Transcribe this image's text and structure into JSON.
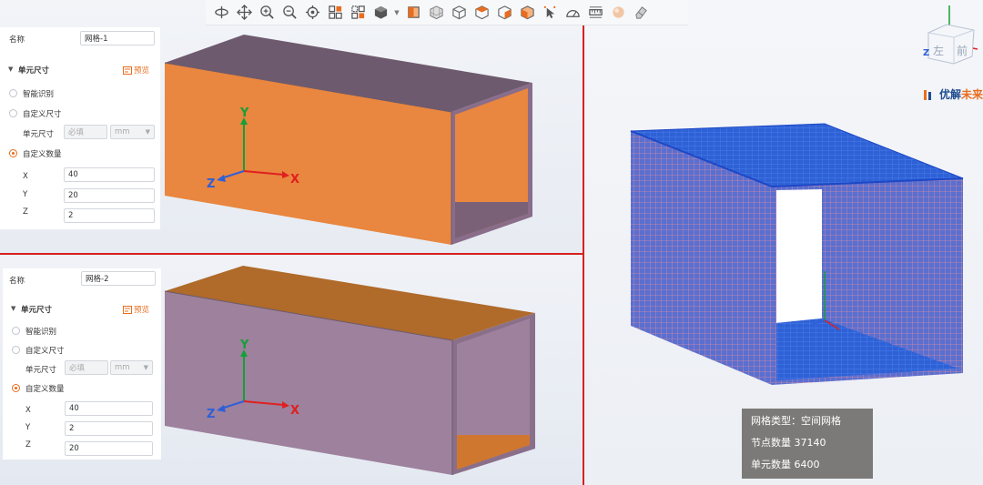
{
  "toolbar": {
    "icons": [
      "rotate-icon",
      "pan-icon",
      "zoom-in-icon",
      "zoom-out-icon",
      "target-icon",
      "fit-all-icon",
      "fit-selection-icon",
      "view-cube-icon",
      "front-view-icon",
      "grid-cube-icon",
      "iso-view-icon",
      "top-view-icon",
      "right-view-icon",
      "bottom-view-icon",
      "select-point-icon",
      "angle-measure-icon",
      "ruler-icon",
      "material-sphere-icon",
      "eraser-icon"
    ]
  },
  "panel1": {
    "name_label": "名称",
    "name_value": "网格-1",
    "section_title": "单元尺寸",
    "preview_label": "预览",
    "smart_label": "智能识别",
    "custom_size_label": "自定义尺寸",
    "unit_size_label": "单元尺寸",
    "unit_size_placeholder": "必填",
    "unit_value": "mm",
    "custom_count_label": "自定义数量",
    "x_label": "X",
    "x_value": "40",
    "y_label": "Y",
    "y_value": "20",
    "z_label": "Z",
    "z_value": "2"
  },
  "panel2": {
    "name_label": "名称",
    "name_value": "网格-2",
    "section_title": "单元尺寸",
    "preview_label": "预览",
    "smart_label": "智能识别",
    "custom_size_label": "自定义尺寸",
    "unit_size_label": "单元尺寸",
    "unit_size_placeholder": "必填",
    "unit_value": "mm",
    "custom_count_label": "自定义数量",
    "x_label": "X",
    "x_value": "40",
    "y_label": "Y",
    "y_value": "2",
    "z_label": "Z",
    "z_value": "20"
  },
  "axes": {
    "x": "X",
    "y": "Y",
    "z": "Z"
  },
  "viewcube": {
    "face_left": "左",
    "face_front": "前"
  },
  "brand": {
    "part_a": "优解",
    "part_b": "未来"
  },
  "info": {
    "mesh_type": "网格类型：空间网格",
    "node_count": "节点数量 37140",
    "element_count": "单元数量 6400"
  },
  "colors": {
    "accent": "#e86d1f",
    "divider": "#d9201f",
    "orange_face": "#e9863f",
    "purple_face": "#9d819d",
    "dark_top": "#6e5a6e",
    "mesh_blue": "#2e63d8",
    "axis_x": "#e02020",
    "axis_y": "#14a038",
    "axis_z": "#2f5fd8"
  }
}
